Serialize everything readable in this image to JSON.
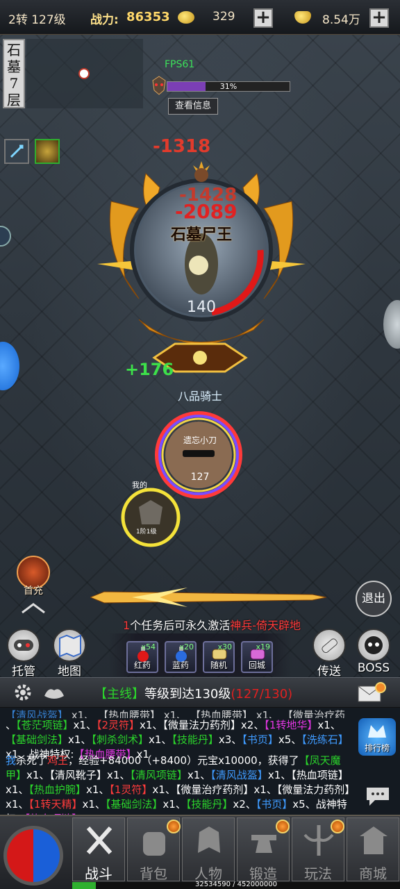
{
  "topbar": {
    "level": "2转 127级",
    "power_label": "战力:",
    "power_value": "86353",
    "gold": "329",
    "yuanbao": "8.54万"
  },
  "map": {
    "name": "石墓7层"
  },
  "fps": "FPS61",
  "boss": {
    "hp_percent": 31,
    "hp_label": "31%",
    "view_info": "查看信息",
    "name": "石墓尸王",
    "level": "140",
    "damage_1": "-1318",
    "damage_2": "-1428",
    "damage_3": "-2089"
  },
  "player": {
    "heal": "+176",
    "title": "八品骑士",
    "name": "遗忘小刀",
    "level": "127",
    "pet_name": "我的",
    "pet_level": "1阶1级"
  },
  "side": {
    "first_recharge": "首充",
    "exit": "退出"
  },
  "task": {
    "count": "1",
    "text": "个任务后可永久激活",
    "reward": "神兵-倚天辟地"
  },
  "quick": {
    "auto": "托管",
    "map": "地图",
    "teleport": "传送",
    "boss": "BOSS"
  },
  "potions": [
    {
      "label": "红药",
      "count": "x54"
    },
    {
      "label": "蓝药",
      "count": "x20"
    },
    {
      "label": "随机",
      "count": "x30"
    },
    {
      "label": "回城",
      "count": "x19"
    }
  ],
  "quest": {
    "tag": "【主线】",
    "desc": "等级到达130级",
    "progress": "(127/130)"
  },
  "chat": {
    "ranking": "排行榜"
  },
  "nav": {
    "tabs": [
      {
        "label": "战斗",
        "active": true
      },
      {
        "label": "背包"
      },
      {
        "label": "人物"
      },
      {
        "label": "锻造"
      },
      {
        "label": "玩法"
      },
      {
        "label": "商城"
      }
    ],
    "exp": "32534590 / 452000000",
    "exp_fraction": 0.072
  },
  "colors": {
    "accent_gold": "#f0c040",
    "hp_red": "#e01818",
    "boss_bar": "#7b3fb5",
    "item_green": "#2bd42b",
    "item_red": "#ff3b3b",
    "item_blue": "#3f9bff",
    "item_magenta": "#e236e2"
  }
}
